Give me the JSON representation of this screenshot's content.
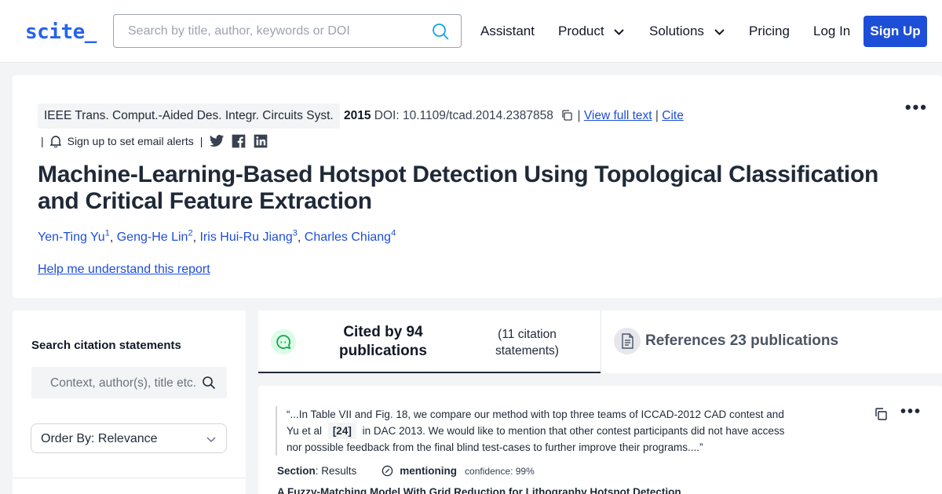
{
  "header": {
    "logo": "scite_",
    "search_placeholder": "Search by title, author, keywords or DOI",
    "nav": {
      "assistant": "Assistant",
      "product": "Product",
      "solutions": "Solutions",
      "pricing": "Pricing",
      "login": "Log In",
      "signup": "Sign Up"
    },
    "accent": "#1d4ed8"
  },
  "report": {
    "journal": "IEEE Trans. Comput.-Aided Des. Integr. Circuits Syst.",
    "year": "2015",
    "doi_label": "DOI: 10.1109/tcad.2014.2387858",
    "pipe": "|",
    "view_full_text": "View full text",
    "cite": "Cite",
    "email_alerts": "Sign up to set email alerts",
    "title": "Machine-Learning-Based Hotspot Detection Using Topological Classification and Critical Feature Extraction",
    "authors": [
      {
        "name": "Yen-Ting Yu",
        "sup": "1"
      },
      {
        "name": "Geng-He Lin",
        "sup": "2"
      },
      {
        "name": "Iris Hui-Ru Jiang",
        "sup": "3"
      },
      {
        "name": "Charles Chiang",
        "sup": "4"
      }
    ],
    "author_sep": ",",
    "help_link": "Help me understand this report"
  },
  "filters": {
    "search_label": "Search citation statements",
    "context_placeholder": "Context, author(s), title etc.",
    "order_by": "Order By: Relevance"
  },
  "tabs": {
    "cited_by": "Cited by 94 publications",
    "citation_statements": "(11 citation statements)",
    "references": "References 23 publications"
  },
  "citation": {
    "quote_before": "“...In Table VII and Fig. 18, we compare our method with top three teams of ICCAD-2012 CAD contest and Yu et al",
    "ref": "[24]",
    "quote_after": "in DAC 2013. We would like to mention that other contest participants did not have access nor possible feedback from the final blind test-cases to further improve their programs....”",
    "section_label": "Section",
    "section_value": ": Results",
    "type": "mentioning",
    "confidence": "confidence: 99%",
    "next_title": "A Fuzzy-Matching Model With Grid Reduction for Lithography Hotspot Detection"
  }
}
